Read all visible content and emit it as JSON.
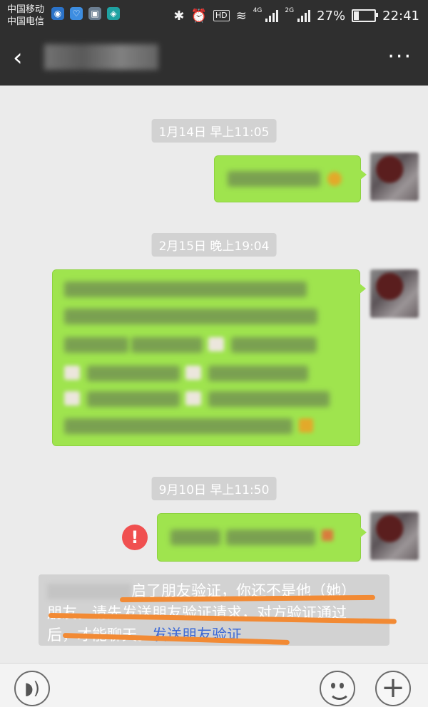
{
  "status_bar": {
    "carrier_1": "中国移动",
    "carrier_2": "中国电信",
    "network_1": "4G",
    "network_2": "2G",
    "battery_percent": "27%",
    "battery_level": 0.27,
    "time": "22:41",
    "hd_label": "HD"
  },
  "title_bar": {
    "back_icon": "chevron-left-icon",
    "more_icon": "more-dots-icon"
  },
  "messages": [
    {
      "timestamp": "1月14日 早上11:05"
    },
    {
      "timestamp": "2月15日 晚上19:04"
    },
    {
      "timestamp": "9月10日 早上11:50",
      "send_failed": true
    }
  ],
  "system_note": {
    "text_part1": "启了朋友验证，你还不是他（她）",
    "text_part2": "朋友。请先发送朋友验证请求，对方验证通过",
    "text_part3": "后，才能聊天。",
    "link_text": "发送朋友验证"
  },
  "colors": {
    "bubble_green": "#9fe44e",
    "link_blue": "#3d6ad6",
    "error_red": "#f05050",
    "annotation_orange": "#f28a34"
  },
  "input_bar": {
    "voice_icon": "voice-icon",
    "emoji_icon": "emoji-icon",
    "plus_icon": "plus-icon"
  }
}
